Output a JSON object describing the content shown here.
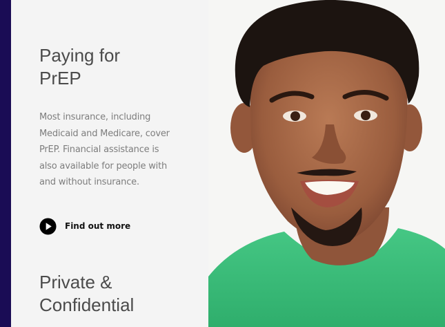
{
  "sections": [
    {
      "title": "Paying for\nPrEP",
      "body": "Most insurance, including Medicaid and Medicare, cover PrEP. Financial assistance is also available for people with and without insurance.",
      "cta_label": "Find out more"
    },
    {
      "title": "Private &\nConfidential"
    }
  ],
  "colors": {
    "frame_background": "#1a0c55",
    "panel_background": "#f4f4f4",
    "heading": "#4b4b4b",
    "body_text": "#7d7d7d",
    "shirt": "#3fbf7a"
  },
  "icons": {
    "cta_icon": "play-circle-icon"
  }
}
